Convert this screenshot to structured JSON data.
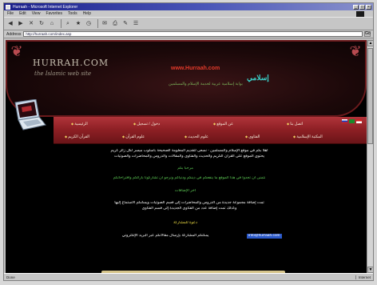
{
  "window": {
    "title": "Hurraah - Microsoft Internet Explorer",
    "controls": [
      "_",
      "□",
      "×"
    ]
  },
  "menubar": {
    "items": [
      "File",
      "Edit",
      "View",
      "Favorites",
      "Tools",
      "Help"
    ]
  },
  "addressbar": {
    "label": "Address",
    "url": "http://hurraah.com/index.asp",
    "go_label": "Go"
  },
  "statusbar": {
    "text": "Done",
    "zone": "Internet"
  },
  "page": {
    "logo": "HURRAH.COM",
    "tagline": "the Islamic web site",
    "url_text": "www.Hurraah.com",
    "arabic_title": "إسلامي",
    "arabic_subtitle": "بوابة إسلامية عربية لخدمة الإسلام والمسلمين",
    "nav_row1": [
      "الرئيسية",
      "دخول / تسجيل",
      "عن الموقع",
      "اتصل بنا"
    ],
    "nav_row2": [
      "القرآن الكريم",
      "علوم القرآن",
      "علوم الحديث",
      "الفتاوى",
      "المكتبة الإسلامية"
    ],
    "content": {
      "line1": "أهلاً بكم في موقع الإسلام والمسلمين - نسعى لتقديم المعلومة الصحيحة بأسلوب ميسر لكل زائر كريم",
      "line2": "يحتوي الموقع على القرآن الكريم والحديث والفتاوى والمقالات والدروس والمحاضرات والصوتيات",
      "heading1": "مرحباً بكم",
      "line3": "نتمنى أن تجدوا في هذا الموقع ما ينفعكم في دينكم ودنياكم ونرجو أن تشاركونا بآرائكم واقتراحاتكم",
      "heading2": "آخر الإضافات",
      "line4": "تمت إضافة مجموعة جديدة من الدروس والمحاضرات إلى قسم الصوتيات ويمكنكم الاستماع إليها",
      "line5": "وكذلك تمت إضافة عدد من الفتاوى الجديدة إلى قسم الفتاوى",
      "heading3": "دعوة للمشاركة",
      "line6": "يمكنكم المشاركة بإرسال مقالاتكم عبر البريد الإلكتروني",
      "email": "info@hurraah.com"
    }
  },
  "colors": {
    "banner_bg": "#1b0809",
    "nav_red": "#8c1f24",
    "accent_green": "#58c050",
    "accent_yellow": "#e0d040"
  }
}
